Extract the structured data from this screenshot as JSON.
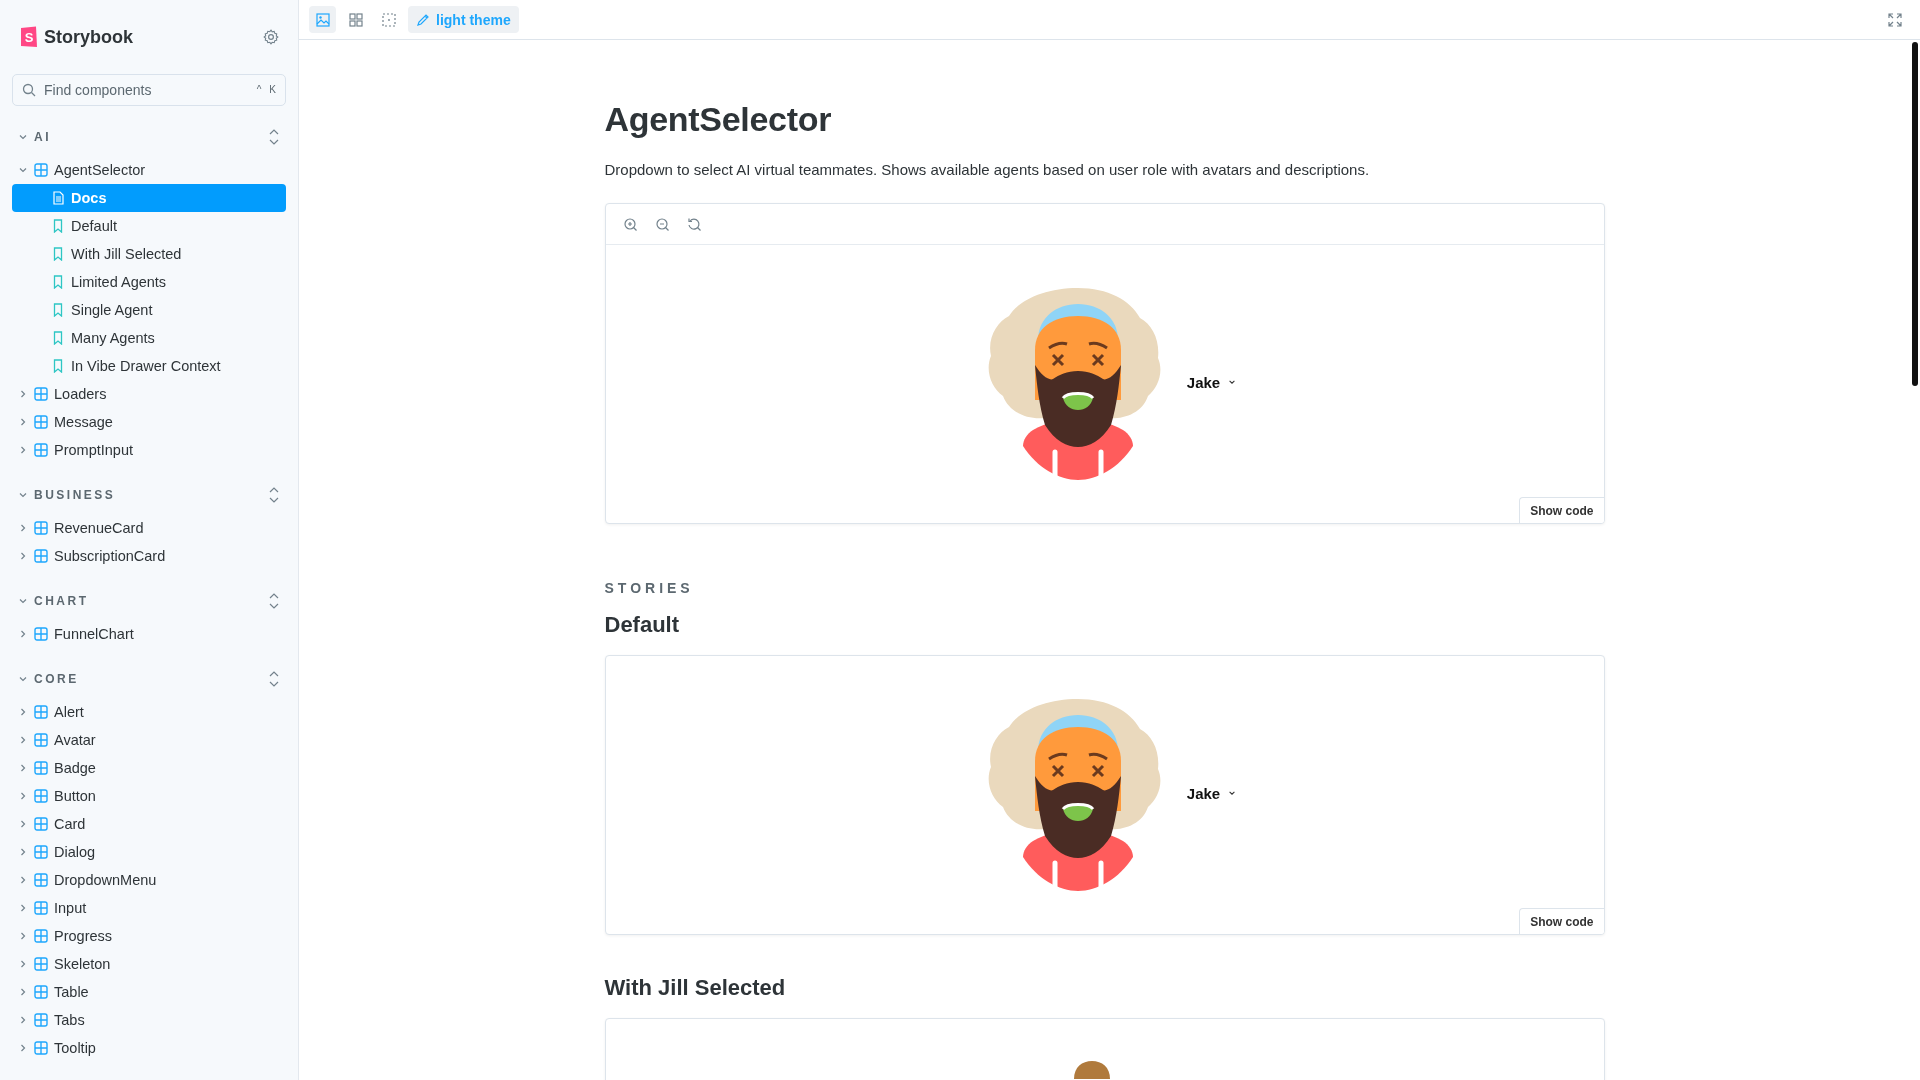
{
  "sidebar": {
    "logo_letter": "S",
    "brand": "Storybook",
    "search": {
      "placeholder": "Find components",
      "keys": [
        "^",
        "K"
      ]
    },
    "sections": [
      {
        "title": "AI",
        "expanded": true,
        "items": [
          {
            "label": "AgentSelector",
            "kind": "component",
            "expanded": true,
            "selected": false,
            "children": [
              {
                "label": "Docs",
                "kind": "docs",
                "selected": true
              },
              {
                "label": "Default",
                "kind": "story",
                "selected": false
              },
              {
                "label": "With Jill Selected",
                "kind": "story",
                "selected": false
              },
              {
                "label": "Limited Agents",
                "kind": "story",
                "selected": false
              },
              {
                "label": "Single Agent",
                "kind": "story",
                "selected": false
              },
              {
                "label": "Many Agents",
                "kind": "story",
                "selected": false
              },
              {
                "label": "In Vibe Drawer Context",
                "kind": "story",
                "selected": false
              }
            ]
          },
          {
            "label": "Loaders",
            "kind": "component",
            "expanded": false,
            "selected": false
          },
          {
            "label": "Message",
            "kind": "component",
            "expanded": false,
            "selected": false
          },
          {
            "label": "PromptInput",
            "kind": "component",
            "expanded": false,
            "selected": false
          }
        ]
      },
      {
        "title": "BUSINESS",
        "expanded": true,
        "items": [
          {
            "label": "RevenueCard",
            "kind": "component",
            "expanded": false,
            "selected": false
          },
          {
            "label": "SubscriptionCard",
            "kind": "component",
            "expanded": false,
            "selected": false
          }
        ]
      },
      {
        "title": "CHART",
        "expanded": true,
        "items": [
          {
            "label": "FunnelChart",
            "kind": "component",
            "expanded": false,
            "selected": false
          }
        ]
      },
      {
        "title": "CORE",
        "expanded": true,
        "items": [
          {
            "label": "Alert",
            "kind": "component",
            "expanded": false,
            "selected": false
          },
          {
            "label": "Avatar",
            "kind": "component",
            "expanded": false,
            "selected": false
          },
          {
            "label": "Badge",
            "kind": "component",
            "expanded": false,
            "selected": false
          },
          {
            "label": "Button",
            "kind": "component",
            "expanded": false,
            "selected": false
          },
          {
            "label": "Card",
            "kind": "component",
            "expanded": false,
            "selected": false
          },
          {
            "label": "Dialog",
            "kind": "component",
            "expanded": false,
            "selected": false
          },
          {
            "label": "DropdownMenu",
            "kind": "component",
            "expanded": false,
            "selected": false
          },
          {
            "label": "Input",
            "kind": "component",
            "expanded": false,
            "selected": false
          },
          {
            "label": "Progress",
            "kind": "component",
            "expanded": false,
            "selected": false
          },
          {
            "label": "Skeleton",
            "kind": "component",
            "expanded": false,
            "selected": false
          },
          {
            "label": "Table",
            "kind": "component",
            "expanded": false,
            "selected": false
          },
          {
            "label": "Tabs",
            "kind": "component",
            "expanded": false,
            "selected": false
          },
          {
            "label": "Tooltip",
            "kind": "component",
            "expanded": false,
            "selected": false
          }
        ]
      }
    ]
  },
  "toolbar": {
    "tools": [
      {
        "kind": "image",
        "selected": true
      },
      {
        "kind": "grid",
        "selected": false
      },
      {
        "kind": "outline",
        "selected": false
      }
    ],
    "theme_button": {
      "label": "light theme"
    }
  },
  "docs": {
    "title": "AgentSelector",
    "description": "Dropdown to select AI virtual teammates. Shows available agents based on user role with avatars and descriptions.",
    "preview": {
      "agent_name": "Jake",
      "show_code": "Show code"
    },
    "stories_label": "STORIES",
    "stories": [
      {
        "title": "Default",
        "agent_name": "Jake",
        "show_code": "Show code"
      },
      {
        "title": "With Jill Selected"
      }
    ]
  }
}
